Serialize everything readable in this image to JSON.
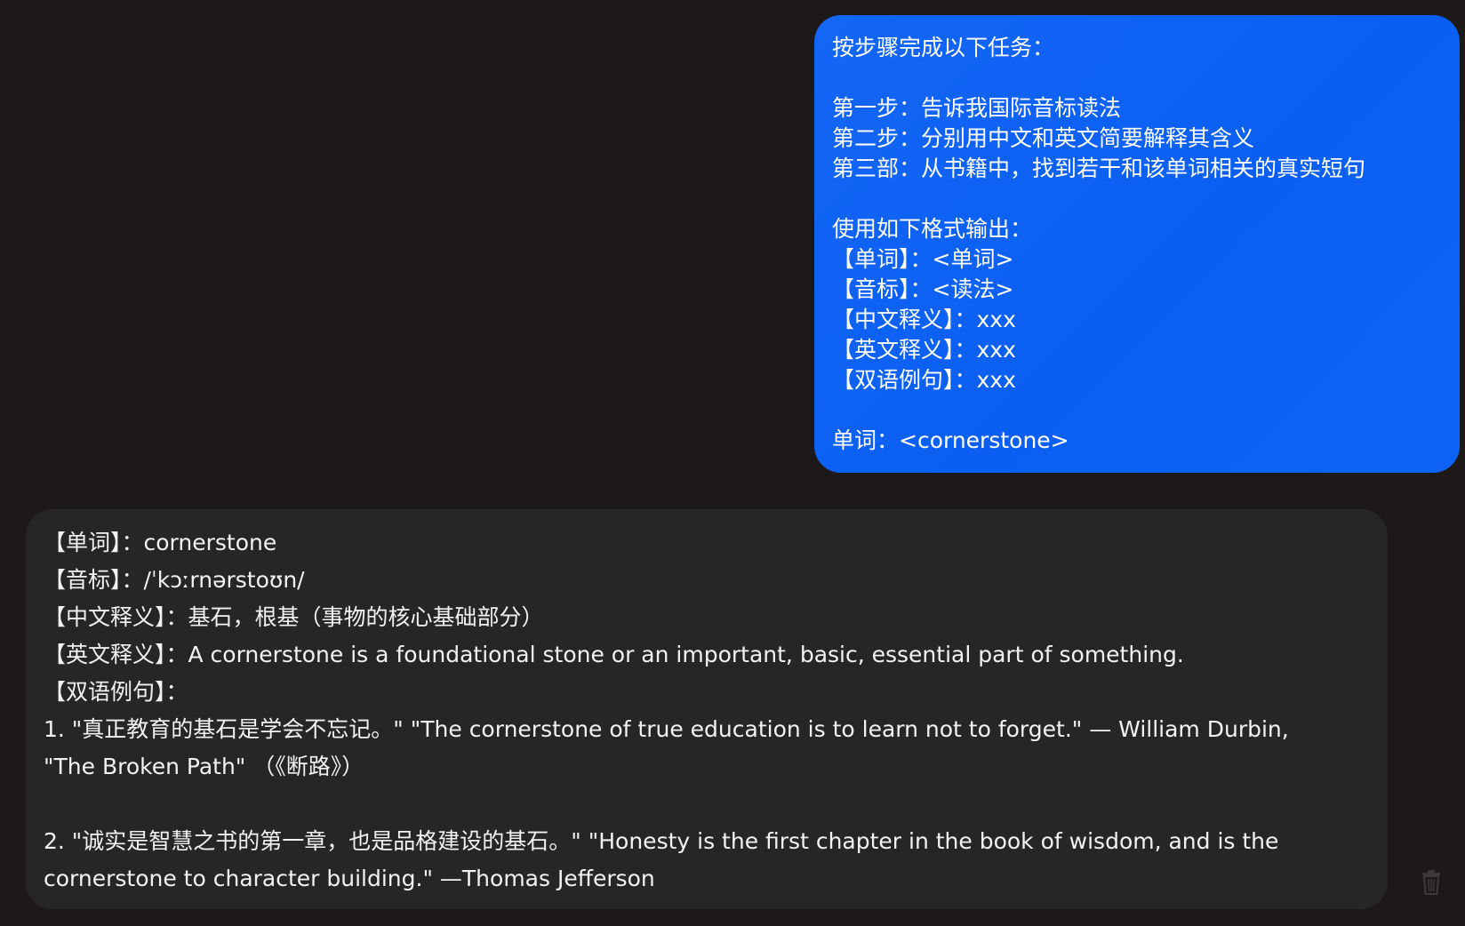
{
  "user_message": {
    "lines": [
      "按步骤完成以下任务：",
      "",
      "第一步：告诉我国际音标读法",
      "第二步：分别用中文和英文简要解释其含义",
      "第三部：从书籍中，找到若干和该单词相关的真实短句",
      "",
      "使用如下格式输出：",
      "【单词】：<单词>",
      "【音标】：<读法>",
      "【中文释义】：xxx",
      "【英文释义】：xxx",
      "【双语例句】：xxx",
      "",
      "单词：<cornerstone>"
    ],
    "colors": {
      "bubble": "#0a5ff2",
      "text": "#ffffff"
    }
  },
  "assistant_message": {
    "word_line": "【单词】：cornerstone",
    "phonetic_line": "【音标】：/ˈkɔːrnərstoʊn/",
    "cn_def_line": "【中文释义】：基石，根基（事物的核心基础部分）",
    "en_def_line": "【英文释义】：A cornerstone is a foundational stone or an important, basic, essential part of something.",
    "examples_label": "【双语例句】：",
    "example1_line1": "1. \"真正教育的基石是学会不忘记。\" \"The cornerstone of true education is to learn not to forget.\" — William Durbin,",
    "example1_line2": "\"The Broken Path\" （《断路》）",
    "example2_line1": "2. \"诚实是智慧之书的第一章，也是品格建设的基石。\" \"Honesty is the first chapter in the book of wisdom, and is the",
    "example2_line2": "cornerstone to character building.\" —Thomas Jefferson",
    "colors": {
      "bubble": "#262626",
      "text": "#f2f2f2"
    }
  },
  "icons": {
    "trash": "trash-icon"
  },
  "background": "#1e1919"
}
